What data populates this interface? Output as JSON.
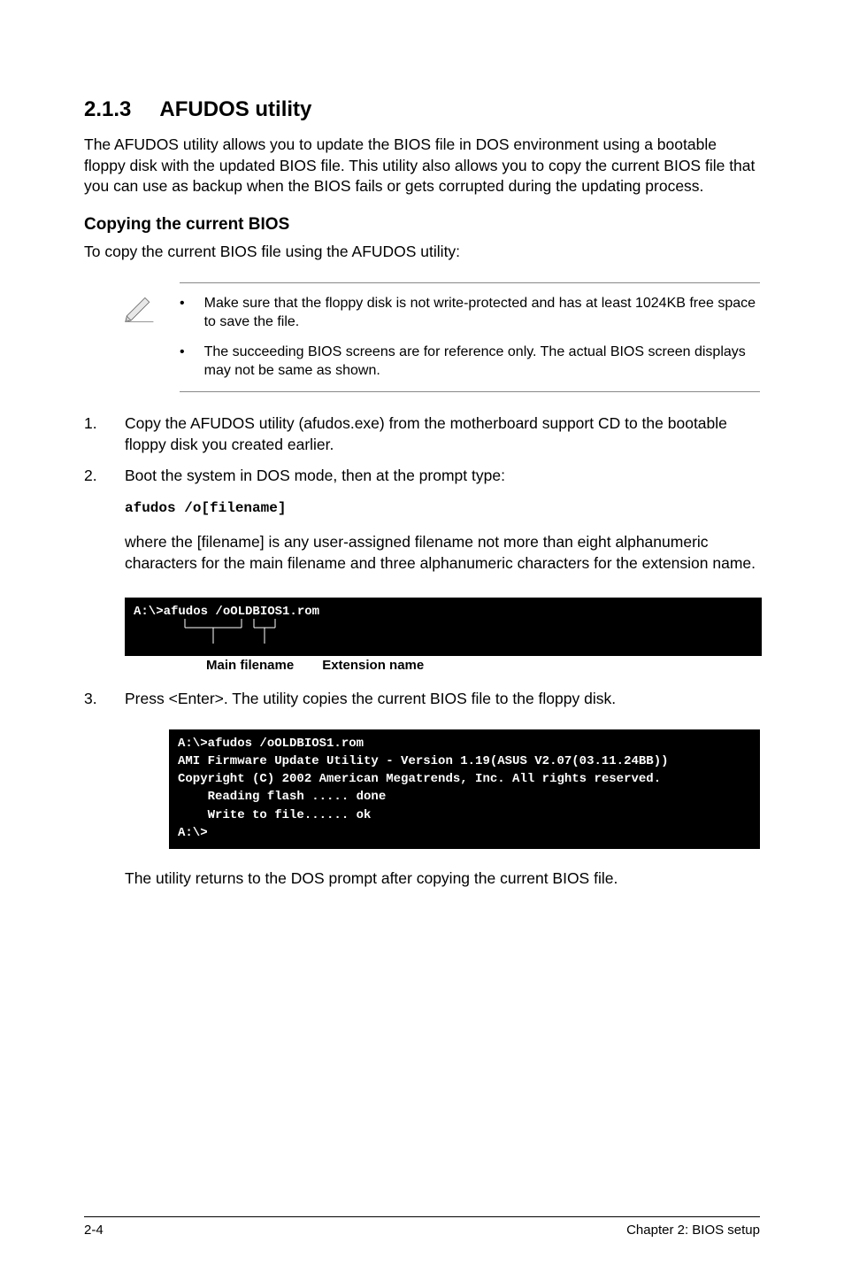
{
  "heading": {
    "number": "2.1.3",
    "title": "AFUDOS utility"
  },
  "intro": "The AFUDOS utility allows you to update the BIOS file in DOS environment using a bootable floppy disk with the updated BIOS file. This utility also allows you to copy the current BIOS file that you can use as backup when the BIOS fails or gets corrupted during the updating process.",
  "sub1": {
    "title": "Copying the current BIOS",
    "lead": "To copy the current BIOS file using the AFUDOS utility:"
  },
  "notes": {
    "items": [
      "Make sure that the floppy disk is not write-protected and has at least 1024KB free space to save the file.",
      "The succeeding BIOS screens are for reference only. The actual BIOS screen displays may not be same as shown."
    ]
  },
  "steps": [
    {
      "n": "1.",
      "text": "Copy the AFUDOS utility (afudos.exe) from the motherboard support CD to the bootable floppy disk you created earlier."
    },
    {
      "n": "2.",
      "text": "Boot the system in DOS mode, then at the prompt type:",
      "cmd": "afudos /o[filename]",
      "para": "where the [filename] is any user-assigned filename not more than eight alphanumeric characters  for the main filename and three alphanumeric characters for the extension name."
    },
    {
      "n": "3.",
      "text": "Press <Enter>. The utility copies the current BIOS file to the floppy disk."
    }
  ],
  "terminal1": {
    "line": "A:\\>afudos /oOLDBIOS1.rom",
    "label_main": "Main filename",
    "label_ext": "Extension name"
  },
  "terminal2": {
    "l1": "A:\\>afudos /oOLDBIOS1.rom",
    "l2": "AMI Firmware Update Utility - Version 1.19(ASUS V2.07(03.11.24BB))",
    "l3": "Copyright (C) 2002 American Megatrends, Inc. All rights reserved.",
    "l4": "    Reading flash ..... done",
    "l5": "    Write to file...... ok",
    "l6": "A:\\>"
  },
  "after_terminal": "The utility returns to the DOS prompt after copying the current BIOS file.",
  "footer": {
    "left": "2-4",
    "right": "Chapter 2: BIOS setup"
  }
}
